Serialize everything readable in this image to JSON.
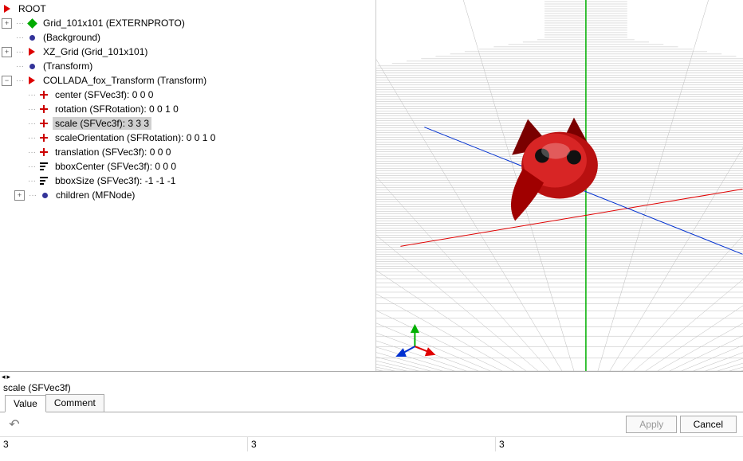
{
  "tree": {
    "root": "ROOT",
    "n1": "Grid_101x101 (EXTERNPROTO)",
    "n2": "(Background)",
    "n3": "XZ_Grid (Grid_101x101)",
    "n4": "(Transform)",
    "n5": "COLLADA_fox_Transform (Transform)",
    "c1": "center (SFVec3f): 0  0  0",
    "c2": "rotation (SFRotation): 0  0  1  0",
    "c3": "scale (SFVec3f): 3  3  3",
    "c4": "scaleOrientation (SFRotation): 0  0  1  0",
    "c5": "translation (SFVec3f): 0  0  0",
    "c6": "bboxCenter (SFVec3f): 0  0  0",
    "c7": "bboxSize (SFVec3f): -1  -1  -1",
    "c8": "children (MFNode)"
  },
  "prop": {
    "title": "scale (SFVec3f)",
    "tab_value": "Value",
    "tab_comment": "Comment",
    "apply": "Apply",
    "cancel": "Cancel",
    "v0": "3",
    "v1": "3",
    "v2": "3"
  }
}
